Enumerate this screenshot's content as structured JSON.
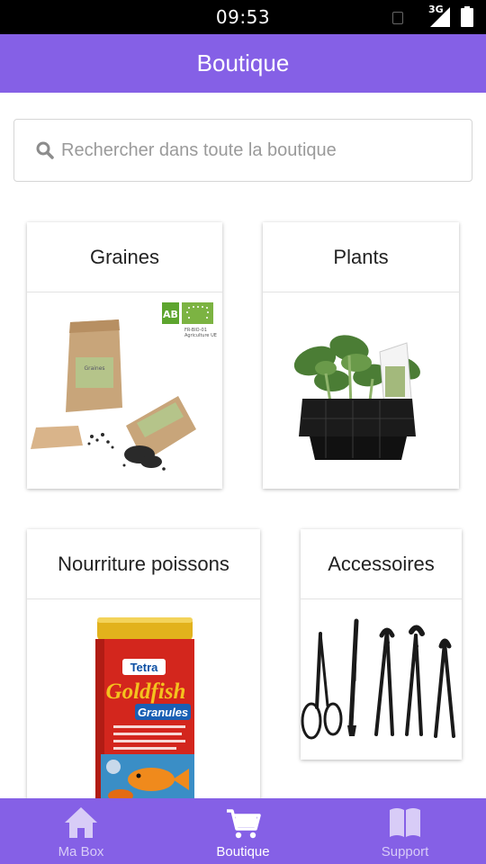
{
  "status_bar": {
    "time": "09:53",
    "network": "3G"
  },
  "app_bar": {
    "title": "Boutique"
  },
  "search": {
    "placeholder": "Rechercher dans toute la boutique"
  },
  "categories": [
    {
      "title": "Graines",
      "image": "seed-packets-image",
      "badge_text": "FR-BIO-01 Agriculture UE"
    },
    {
      "title": "Plants",
      "image": "seedling-tray-image"
    },
    {
      "title": "Nourriture poissons",
      "image": "fish-food-can-image",
      "brand_text": "Tetra",
      "product_text": "Goldfish",
      "product_sub": "Granules"
    },
    {
      "title": "Accessoires",
      "image": "gardening-tools-image"
    }
  ],
  "bottom_nav": [
    {
      "label": "Ma Box",
      "icon": "home-icon",
      "active": false
    },
    {
      "label": "Boutique",
      "icon": "cart-icon",
      "active": true
    },
    {
      "label": "Support",
      "icon": "book-icon",
      "active": false
    }
  ],
  "colors": {
    "primary": "#8560e6",
    "nav_inactive": "#d8ccf7",
    "nav_active": "#ffffff"
  }
}
